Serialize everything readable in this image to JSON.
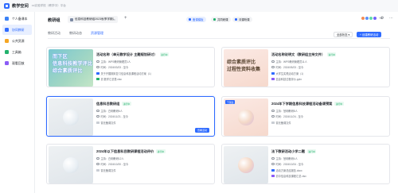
{
  "app": {
    "brand": "教学空间",
    "org": "xx实验学校（教学中）平台"
  },
  "sidebar": {
    "items": [
      {
        "label": "个人备课本",
        "icon": "book-icon",
        "color": "#3b82f6",
        "active": false
      },
      {
        "label": "协同教研",
        "icon": "team-icon",
        "color": "#2f6bff",
        "active": true
      },
      {
        "label": "公共资源",
        "icon": "folder-icon",
        "color": "#f5a623",
        "active": false
      },
      {
        "label": "工具箱",
        "icon": "toolbox-icon",
        "color": "#23b26d",
        "active": false
      },
      {
        "label": "观看回放",
        "icon": "play-icon",
        "color": "#8b5cf6",
        "active": false
      }
    ]
  },
  "header": {
    "title": "教研组",
    "tab_label": "信息科技教研组2023秋季学期活动",
    "pill_1": "备课模板",
    "pill_2": "共同研课",
    "pill_3": "评课听课",
    "avatar_count": "+8"
  },
  "subtabs": [
    {
      "label": "教研活动",
      "active": false
    },
    {
      "label": "教研动态",
      "active": false
    },
    {
      "label": "资源管理",
      "active": true
    }
  ],
  "toolbar": {
    "filter_label": "全部状态 ▾",
    "new_label": "+ 创建教研活动"
  },
  "cards": [
    {
      "title": "活动名称（单元教学设计 主题规划研讨）",
      "status": "进行中",
      "thumb_style": "green",
      "thumb_text": [
        "而下区",
        "信息科技教学评比",
        "综合素质评比"
      ],
      "meta": [
        {
          "text": "主持：WPS教研管理员1人"
        },
        {
          "text": "时间：2024/03/23 - 至今"
        },
        {
          "text": "关于开展期末复习信息科技课程活动方案（1）",
          "file_color": "#2f6bff"
        },
        {
          "text": "初 数学汇总表.xlsx",
          "file_color": "#23b26d"
        }
      ]
    },
    {
      "title": "活动名称说明文（教研组主持文件）",
      "status": "进行中",
      "thumb_style": "pink",
      "thumb_text": [
        "综合素质评比",
        "过程性资料收集"
      ],
      "meta": [
        {
          "text": "主持：WPS教研管理员11人"
        },
        {
          "text": "时间：2024/05/23 - 至今"
        },
        {
          "text": "大学生实践活动方案（1）",
          "file_color": "#2f6bff"
        },
        {
          "text": "信息科技过程评价.pptx",
          "file_color": "#8b5cf6"
        }
      ]
    },
    {
      "title": "信息科目教研组",
      "status": "进行中",
      "thumb_style": "gray",
      "thumb_text": [],
      "meta": [
        {
          "text": "主持：白明教研6人"
        },
        {
          "text": "时间：2024/11/21 - 至今"
        },
        {
          "text": "暂无备课文件"
        }
      ],
      "button": "查看活动"
    },
    {
      "title": "2024年下学期信息科技课程活动备课预案",
      "status": "进行中",
      "thumb_style": "pink",
      "badge": "下课后",
      "thumb_text": [],
      "meta": [
        {
          "text": "主持：慧明教研8人"
        },
        {
          "text": "时间：2024/11/24 - 至今"
        },
        {
          "text": "暂无备课文件"
        }
      ]
    },
    {
      "title": "2024年以下信息科目教研课程活动评价",
      "status": "进行中",
      "thumb_style": "gray",
      "thumb_text": [],
      "meta": [
        {
          "text": "主持：白明教研12人"
        },
        {
          "text": "时间：2024/10/20 - 至今"
        },
        {
          "text": "暂无备课文件"
        }
      ]
    },
    {
      "title": "法下教研活动小学二题",
      "status": "进行中",
      "thumb_style": "gray",
      "thumb_text": [],
      "meta": [
        {
          "text": "主持：慧明教研4人"
        },
        {
          "text": "时间：2024/10/24 - 至今"
        },
        {
          "text": "活动方案总结报告.docx",
          "file_color": "#2f6bff"
        },
        {
          "text": "初中信息科技课程汇总.xlsx",
          "file_color": "#8b5cf6"
        }
      ]
    }
  ]
}
